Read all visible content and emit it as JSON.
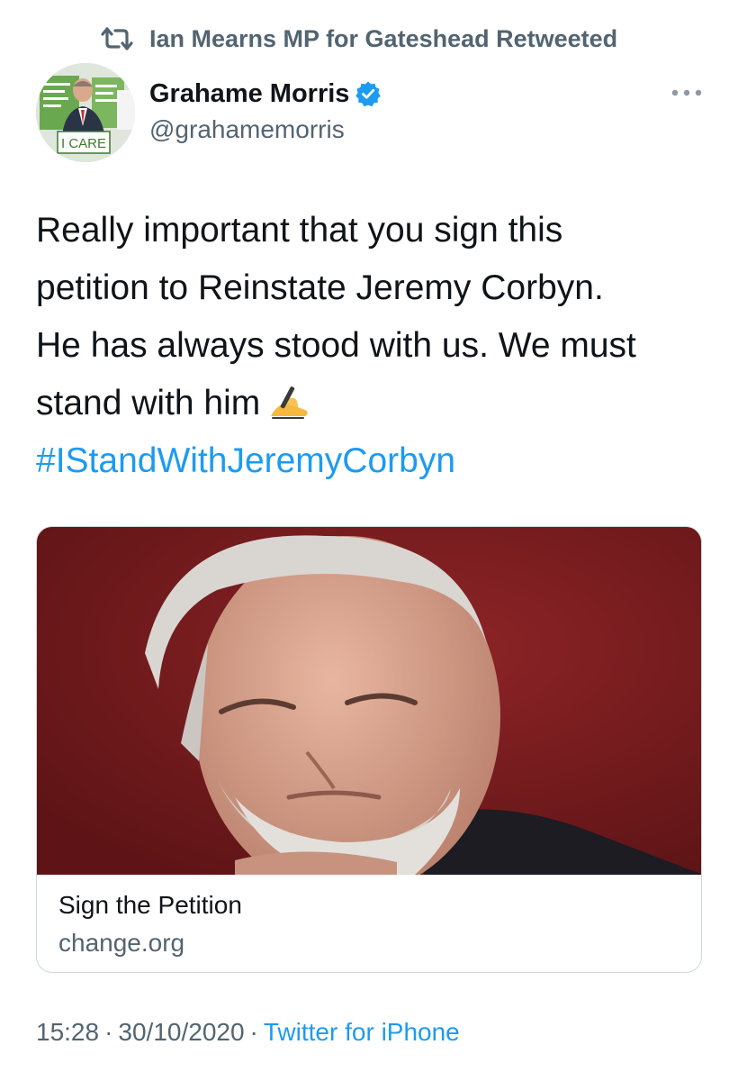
{
  "retweet": {
    "icon": "retweet-icon",
    "text": "Ian Mearns MP for Gateshead Retweeted"
  },
  "author": {
    "name": "Grahame Morris",
    "handle": "@grahamemorris",
    "verified": true,
    "avatar_sign_text": "I CARE"
  },
  "tweet": {
    "lines": [
      "Really important that you sign this",
      "petition to Reinstate Jeremy Corbyn.",
      "He has always stood with us. We must",
      "stand with him"
    ],
    "emoji": "writing-hand-emoji",
    "hashtag": "#IStandWithJeremyCorbyn"
  },
  "card": {
    "title": "Sign the Petition",
    "domain": "change.org"
  },
  "meta": {
    "time": "15:28",
    "date": "30/10/2020",
    "separator": "·",
    "source": "Twitter for iPhone"
  },
  "colors": {
    "link": "#1d9bf0",
    "secondary_text": "#536471",
    "primary_text": "#0f1419",
    "card_border": "#cfd9de",
    "image_background": "#7a1a1c"
  }
}
